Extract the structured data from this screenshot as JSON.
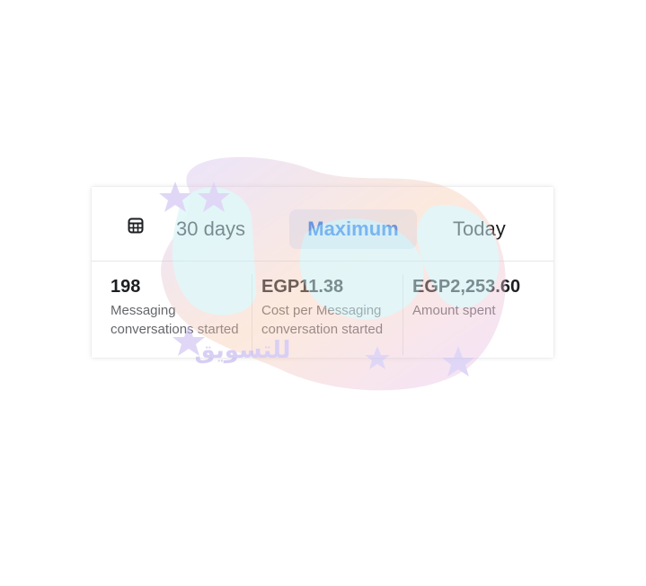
{
  "tabs": {
    "calendar_icon": "calendar-grid-icon",
    "items": [
      {
        "label": "30 days"
      },
      {
        "label": "Maximum",
        "selected": true
      },
      {
        "label": "Today"
      }
    ]
  },
  "metrics": [
    {
      "value": "198",
      "label": "Messaging conversations started"
    },
    {
      "value": "EGP11.38",
      "label": "Cost per Messaging conversation started"
    },
    {
      "value": "EGP2,253.60",
      "label": "Amount spent"
    }
  ],
  "watermark": {
    "text": "للتسويق"
  },
  "colors": {
    "accent": "#1877f2",
    "selected_bg": "#e7f0fd",
    "text_primary": "#1c1e21",
    "text_secondary": "#65676b"
  }
}
